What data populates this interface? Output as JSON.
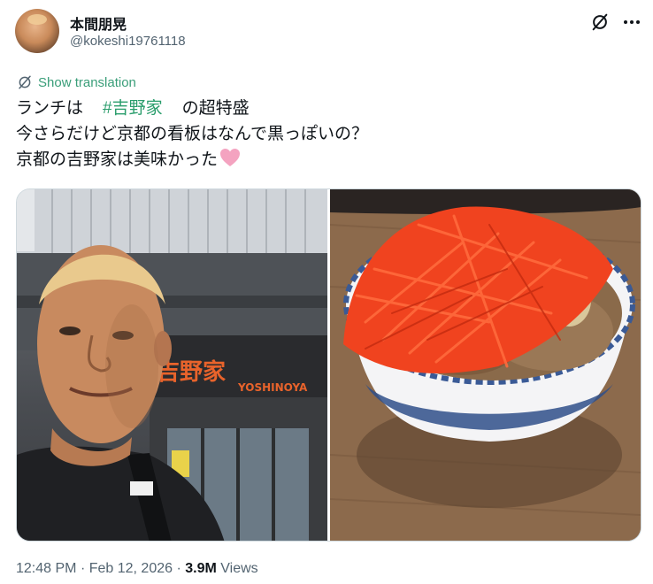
{
  "author": {
    "name": "本間朋晃",
    "handle": "@kokeshi19761118"
  },
  "actions": {
    "grok_icon": "grok-icon",
    "more_icon": "more-horizontal-icon"
  },
  "translate": {
    "label": "Show translation",
    "icon": "translate-icon"
  },
  "tweet": {
    "line1_pre": "ランチは",
    "hashtag": "#吉野家",
    "line1_post": "の超特盛",
    "line2": "今さらだけど京都の看板はなんで黒っぽいの？",
    "line3": "京都の吉野家は美味かった",
    "emoji": "pink-heart"
  },
  "media": {
    "photos": [
      {
        "kind": "selfie-in-front-of-storefront",
        "sign_text_jp": "吉野家",
        "sign_text_en": "YOSHINOYA"
      },
      {
        "kind": "gyudon-bowl-with-red-ginger"
      }
    ]
  },
  "footer": {
    "time": "12:48 PM",
    "date": "Feb 12, 2026",
    "views_count": "3.9M",
    "views_label": "Views"
  },
  "colors": {
    "text_primary": "#0f1419",
    "text_secondary": "#536471",
    "hashtag": "#2a9d6c",
    "translate": "#3a9e79",
    "sign_orange": "#e8632b"
  }
}
